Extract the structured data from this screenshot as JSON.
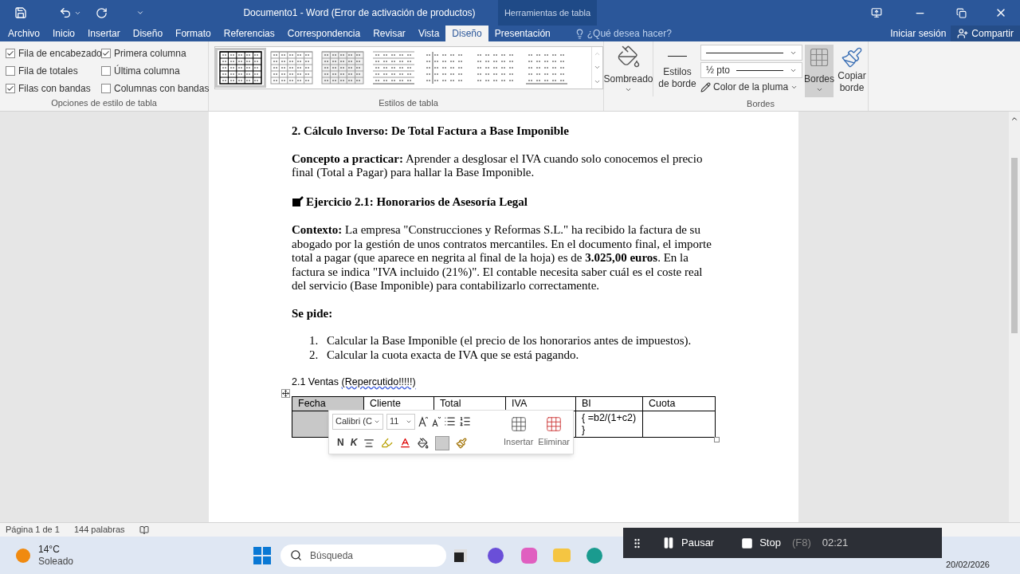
{
  "window": {
    "title": "Documento1 - Word (Error de activación de productos)",
    "context_tab": "Herramientas de tabla"
  },
  "tabs": [
    {
      "label": "Archivo",
      "selected": false
    },
    {
      "label": "Inicio",
      "selected": false
    },
    {
      "label": "Insertar",
      "selected": false
    },
    {
      "label": "Diseño",
      "selected": false
    },
    {
      "label": "Formato",
      "selected": false
    },
    {
      "label": "Referencias",
      "selected": false
    },
    {
      "label": "Correspondencia",
      "selected": false
    },
    {
      "label": "Revisar",
      "selected": false
    },
    {
      "label": "Vista",
      "selected": false
    },
    {
      "label": "Diseño",
      "selected": true
    },
    {
      "label": "Presentación",
      "selected": false
    }
  ],
  "tell_me": {
    "placeholder": "¿Qué desea hacer?"
  },
  "account": {
    "sign_in": "Iniciar sesión",
    "share": "Compartir"
  },
  "ribbon": {
    "style_options": {
      "label": "Opciones de estilo de tabla",
      "items": [
        {
          "label": "Fila de encabezado",
          "checked": true
        },
        {
          "label": "Primera columna",
          "checked": true
        },
        {
          "label": "Fila de totales",
          "checked": false
        },
        {
          "label": "Última columna",
          "checked": false
        },
        {
          "label": "Filas con bandas",
          "checked": true
        },
        {
          "label": "Columnas con bandas",
          "checked": false
        }
      ]
    },
    "table_styles": {
      "label": "Estilos de tabla",
      "items": [
        {
          "selected": true
        },
        {
          "selected": false
        },
        {
          "selected": false
        },
        {
          "selected": false
        },
        {
          "selected": false
        },
        {
          "selected": false
        },
        {
          "selected": false
        }
      ]
    },
    "shading": {
      "label": "Sombreado"
    },
    "borders": {
      "label": "Bordes",
      "border_styles": "Estilos de borde",
      "weight": "½ pto",
      "pen_color": "Color de la pluma",
      "borders_button": {
        "label": "Bordes",
        "pressed": true
      },
      "copy_border": "Copiar borde"
    }
  },
  "document": {
    "heading": "2. Cálculo Inverso: De Total Factura a Base Imponible",
    "concept": "**Concepto a practicar:** Aprender a desglosar el IVA cuando solo conocemos el precio final (Total a Pagar) para hallar la Base Imponible.",
    "exercise_title": "Ejercicio 2.1: Honorarios de Asesoría Legal",
    "context": "**Contexto:** La empresa \"Construcciones y Reformas S.L.\" ha recibido la factura de su abogado por la gestión de unos contratos mercantiles. En el documento final, el importe total a pagar (que aparece en negrita al final de la hoja) es de **3.025,00 euros**. En la factura se indica \"IVA incluido (21%)\". El contable necesita saber cuál es el coste real del servicio (Base Imponible) para contabilizarlo correctamente.",
    "request": "Se pide:",
    "tasks": [
      {
        "number": "1.",
        "text": "Calcular la Base Imponible (el precio de los honorarios antes de impuestos)."
      },
      {
        "number": "2.",
        "text": "Calcular la cuota exacta de IVA que se está pagando."
      }
    ],
    "table_caption": [
      {
        "text": "2.1 Ventas ",
        "misspelled": false
      },
      {
        "text": "(Repercutido!!!!!)",
        "misspelled": true
      }
    ],
    "table": {
      "columns": [
        {
          "label": "Fecha",
          "selected": true
        },
        {
          "label": "Cliente",
          "selected": false
        },
        {
          "label": "Total",
          "selected": false
        },
        {
          "label": "IVA",
          "selected": false
        },
        {
          "label": "BI",
          "selected": false
        },
        {
          "label": "Cuota",
          "selected": false
        }
      ],
      "rows": [
        {
          "cells": [
            null,
            null,
            null,
            null,
            "{ =b2/(1+c2) }",
            null
          ]
        }
      ]
    }
  },
  "mini_toolbar": {
    "font": "Calibri (C",
    "size": "11",
    "bold": "N",
    "italic": "K",
    "insert": "Insertar",
    "delete": "Eliminar"
  },
  "status_bar": {
    "page": "Página 1 de 1",
    "words": "144 palabras"
  },
  "taskbar": {
    "weather": {
      "temperature": "14°C",
      "condition": "Soleado"
    },
    "search": {
      "placeholder": "Búsqueda"
    },
    "date": "20/02/2026"
  },
  "recorder": {
    "pause": "Pausar",
    "stop": "Stop",
    "shortcut": "(F8)",
    "timer": "02:21"
  }
}
